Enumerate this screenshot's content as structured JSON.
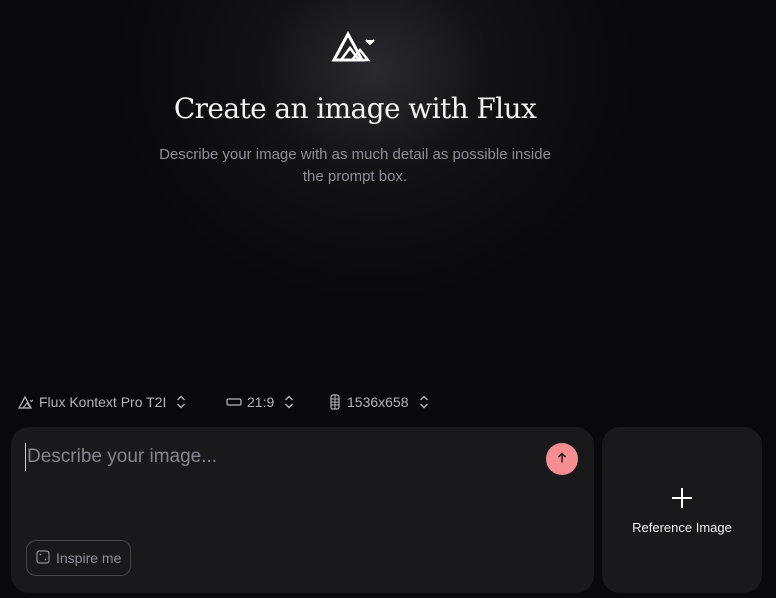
{
  "hero": {
    "logo_icon": "flux-logo-icon",
    "title": "Create an image with Flux",
    "subtitle": "Describe your image with as much detail as possible inside the prompt box."
  },
  "settings": {
    "model": {
      "icon": "flux-model-icon",
      "label": "Flux Kontext Pro T2I",
      "chevron": "chevron-up-down-icon"
    },
    "aspect_ratio": {
      "icon": "aspect-ratio-icon",
      "label": "21:9",
      "chevron": "chevron-up-down-icon"
    },
    "resolution": {
      "icon": "resolution-icon",
      "label": "1536x658",
      "chevron": "chevron-up-down-icon"
    }
  },
  "prompt": {
    "placeholder": "Describe your image...",
    "value": "",
    "submit_icon": "arrow-up-icon",
    "inspire_label": "Inspire me",
    "inspire_icon": "dice-icon"
  },
  "reference": {
    "icon": "plus-icon",
    "label": "Reference Image"
  },
  "colors": {
    "background": "#09090b",
    "card": "#19191c",
    "accent": "#f58d93",
    "muted_text": "#8e8e96"
  }
}
